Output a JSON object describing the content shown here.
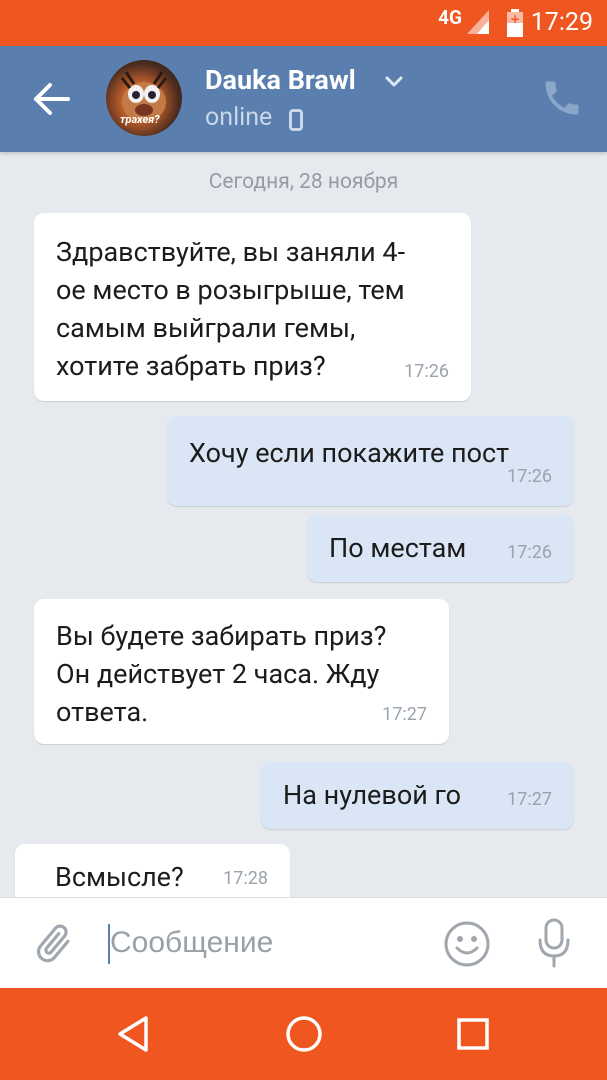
{
  "status_bar": {
    "network": "4G",
    "time": "17:29"
  },
  "header": {
    "title": "Dauka Brawl",
    "status": "online",
    "avatar_caption": "трахея?"
  },
  "date_separator": "Сегодня, 28 ноября",
  "messages": [
    {
      "direction": "incoming",
      "lines": [
        "Здравствуйте, вы заняли 4-",
        "ое место в розыгрыше, тем",
        "самым выйграли гемы,",
        "хотите забрать приз?"
      ],
      "time": "17:26"
    },
    {
      "direction": "outgoing",
      "lines": [
        "Хочу если покажите пост"
      ],
      "time": "17:26"
    },
    {
      "direction": "outgoing",
      "lines": [
        "По местам"
      ],
      "time": "17:26"
    },
    {
      "direction": "incoming",
      "lines": [
        "Вы будете забирать приз?",
        "Он действует 2 часа. Жду",
        "ответа."
      ],
      "time": "17:27"
    },
    {
      "direction": "outgoing",
      "lines": [
        "На нулевой го"
      ],
      "time": "17:27"
    },
    {
      "direction": "incoming",
      "lines": [
        "Всмысле?"
      ],
      "time": "17:28"
    }
  ],
  "input": {
    "placeholder": "Сообщение",
    "value": ""
  },
  "icons": {
    "back": "arrow-left-icon",
    "call": "phone-icon",
    "attach": "paperclip-icon",
    "emoji": "smiley-icon",
    "mic": "microphone-icon",
    "nav_back": "triangle-back-icon",
    "nav_home": "circle-home-icon",
    "nav_recent": "square-recent-icon"
  },
  "colors": {
    "status_bar": "#f0561f",
    "header": "#5a7fae",
    "chat_background": "#e6eaef",
    "incoming_bubble": "#ffffff",
    "outgoing_bubble": "#dae6f5"
  }
}
